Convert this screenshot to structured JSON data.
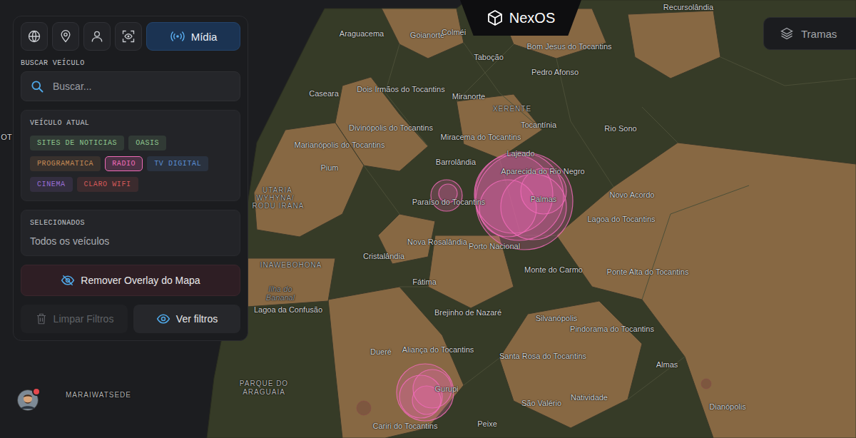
{
  "logo": {
    "text": "NexOS"
  },
  "layers_button": {
    "label": "Tramas"
  },
  "nav_tabs": [
    {
      "label": "",
      "selected": false
    },
    {
      "label": "",
      "selected": false
    },
    {
      "label": "",
      "selected": false
    },
    {
      "label": "",
      "selected": false
    },
    {
      "label": "Mídia",
      "selected": true
    }
  ],
  "search": {
    "label": "BUSCAR VEÍCULO",
    "placeholder": "Buscar..."
  },
  "current_vehicle": {
    "label": "VEÍCULO ATUAL",
    "tags": [
      {
        "label": "SITES DE NOTICIAS",
        "color": "#8fc98f",
        "selected": false
      },
      {
        "label": "OASIS",
        "color": "#8fc98f",
        "selected": false
      },
      {
        "label": "PROGRAMATICA",
        "color": "#c58a55",
        "selected": false
      },
      {
        "label": "RADIO",
        "color": "#f06bb8",
        "selected": true
      },
      {
        "label": "TV DIGITAL",
        "color": "#5b8fd6",
        "selected": false
      },
      {
        "label": "CINEMA",
        "color": "#9a6fd6",
        "selected": false
      },
      {
        "label": "CLARO WIFI",
        "color": "#d65a5a",
        "selected": false
      }
    ]
  },
  "selected": {
    "label": "SELECIONADOS",
    "value": "Todos os veículos"
  },
  "overlay_button": {
    "label": "Remover Overlay do Mapa"
  },
  "clear_button": {
    "label": "Limpar Filtros",
    "disabled": true
  },
  "view_filters_button": {
    "label": "Ver filtros"
  },
  "user": {
    "notification": true
  },
  "map": {
    "labels": [
      {
        "text": "Araguacema",
        "kind": "city"
      },
      {
        "text": "Goianorte",
        "kind": "city"
      },
      {
        "text": "Colméi",
        "kind": "city"
      },
      {
        "text": "Recursolândia",
        "kind": "city"
      },
      {
        "text": "Taboção",
        "kind": "city"
      },
      {
        "text": "Bom Jesus do Tocantins",
        "kind": "city"
      },
      {
        "text": "Pedro Afonso",
        "kind": "city"
      },
      {
        "text": "Caseara",
        "kind": "city"
      },
      {
        "text": "Dois Irmãos do Tocantins",
        "kind": "city"
      },
      {
        "text": "Miranorte",
        "kind": "city"
      },
      {
        "text": "XERENTE",
        "kind": "territory"
      },
      {
        "text": "Tocantínia",
        "kind": "city"
      },
      {
        "text": "Rio Sono",
        "kind": "city"
      },
      {
        "text": "Divinópolis do Tocantins",
        "kind": "city"
      },
      {
        "text": "Marianópolis do Tocantins",
        "kind": "city"
      },
      {
        "text": "Miracema do Tocantins",
        "kind": "city"
      },
      {
        "text": "Lajeado",
        "kind": "city"
      },
      {
        "text": "Barrolândia",
        "kind": "city"
      },
      {
        "text": "Aparecida do Rio Negro",
        "kind": "city"
      },
      {
        "text": "Pium",
        "kind": "city"
      },
      {
        "text": "UTARIA",
        "kind": "territory"
      },
      {
        "text": "WYHYNA/",
        "kind": "territory"
      },
      {
        "text": "RODU IRANA",
        "kind": "territory"
      },
      {
        "text": "Paraíso do Tocantins",
        "kind": "city"
      },
      {
        "text": "Palmas",
        "kind": "city"
      },
      {
        "text": "Novo Acordo",
        "kind": "city"
      },
      {
        "text": "Lagoa do Tocantins",
        "kind": "city"
      },
      {
        "text": "Cristalândia",
        "kind": "city"
      },
      {
        "text": "Nova Rosalândia",
        "kind": "city"
      },
      {
        "text": "Porto Nacional",
        "kind": "city"
      },
      {
        "text": "INAWEBOHONA",
        "kind": "territory"
      },
      {
        "text": "Monte do Carmo",
        "kind": "city"
      },
      {
        "text": "Ponte Alta do Tocantins",
        "kind": "city"
      },
      {
        "text": "Ilha do",
        "kind": "water"
      },
      {
        "text": "Bananal",
        "kind": "water"
      },
      {
        "text": "Fátima",
        "kind": "city"
      },
      {
        "text": "Lagoa da Confusão",
        "kind": "city"
      },
      {
        "text": "Brejinho de Nazaré",
        "kind": "city"
      },
      {
        "text": "Silvanópolis",
        "kind": "city"
      },
      {
        "text": "Pindorama do Tocantins",
        "kind": "city"
      },
      {
        "text": "Dueré",
        "kind": "city"
      },
      {
        "text": "Aliança do Tocantins",
        "kind": "city"
      },
      {
        "text": "Santa Rosa do Tocantins",
        "kind": "city"
      },
      {
        "text": "Almas",
        "kind": "city"
      },
      {
        "text": "PARQUE DO",
        "kind": "territory"
      },
      {
        "text": "ARAGUAIA",
        "kind": "territory"
      },
      {
        "text": "Gurupi",
        "kind": "city"
      },
      {
        "text": "Natividade",
        "kind": "city"
      },
      {
        "text": "São Valério",
        "kind": "city"
      },
      {
        "text": "Dianópolis",
        "kind": "city"
      },
      {
        "text": "Cariri do Tocantins",
        "kind": "city"
      },
      {
        "text": "Peixe",
        "kind": "city"
      },
      {
        "text": "MARAIWATSEDE",
        "kind": "territory"
      },
      {
        "text": "OT",
        "kind": "city"
      }
    ]
  }
}
